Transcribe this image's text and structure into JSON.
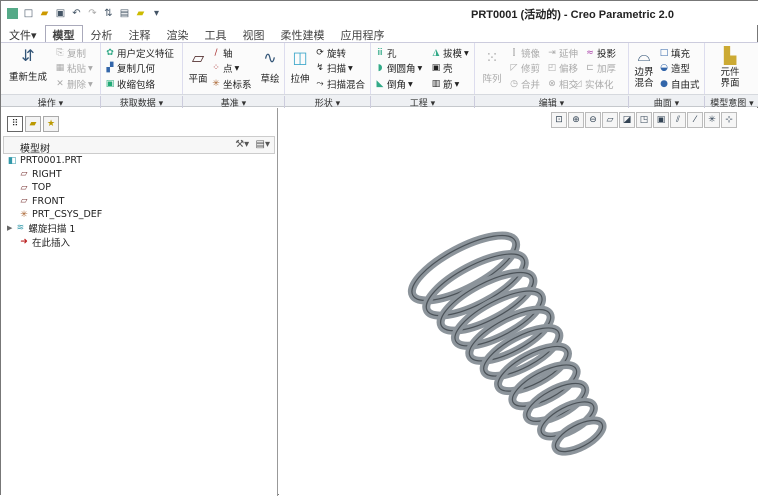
{
  "window": {
    "title": "PRT0001 (活动的) - Creo Parametric 2.0"
  },
  "quick_access": [
    "app-icon",
    "new-icon",
    "open-icon",
    "save-icon",
    "undo-icon",
    "redo-icon",
    "regenerate-icon",
    "windows-icon",
    "close-icon",
    "customize-icon"
  ],
  "tabs": [
    "文件",
    "模型",
    "分析",
    "注释",
    "渲染",
    "工具",
    "视图",
    "柔性建模",
    "应用程序"
  ],
  "active_tab": "模型",
  "ribbon": {
    "operations": {
      "regenerate": "重新生成",
      "copy": "复制",
      "paste": "粘贴",
      "delete": "删除",
      "label": "操作"
    },
    "get_data": {
      "udf": "用户定义特征",
      "copy_geom": "复制几何",
      "shrinkwrap": "收缩包络",
      "label": "获取数据"
    },
    "datum": {
      "plane": "平面",
      "axis": "轴",
      "point": "点",
      "csys": "坐标系",
      "sketch": "草绘",
      "label": "基准"
    },
    "shapes": {
      "extrude": "拉伸",
      "revolve": "旋转",
      "sweep": "扫描",
      "swept_blend": "扫描混合",
      "label": "形状"
    },
    "engineering": {
      "hole": "孔",
      "round": "倒圆角",
      "chamfer": "倒角",
      "draft": "拔模",
      "shell": "壳",
      "rib": "筋",
      "label": "工程"
    },
    "editing": {
      "pattern": "阵列",
      "mirror": "镜像",
      "trim": "修剪",
      "merge": "合并",
      "extend": "延伸",
      "offset": "偏移",
      "intersect": "相交",
      "project": "投影",
      "thicken": "加厚",
      "solidify": "实体化",
      "label": "编辑"
    },
    "surfaces": {
      "boundary_blend": "边界混合",
      "fill": "填充",
      "style": "造型",
      "freestyle": "自由式",
      "label": "曲面"
    },
    "model_intent": {
      "component_interface": "元件界面",
      "label": "模型意图"
    }
  },
  "model_tree": {
    "title": "模型树",
    "items": [
      "PRT0001.PRT",
      "RIGHT",
      "TOP",
      "FRONT",
      "PRT_CSYS_DEF",
      "螺旋扫描 1",
      "在此插入"
    ]
  },
  "colors": {
    "spring": "#8c949b",
    "accent": "#3a6ea5"
  }
}
